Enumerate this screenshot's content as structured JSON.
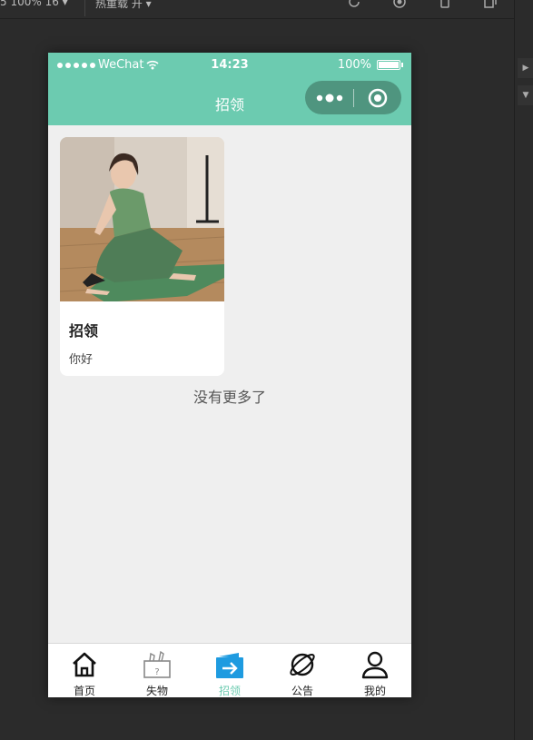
{
  "ide": {
    "zoom_label": "5 100% 16 ▾",
    "reload_label": "热重载 开 ▾"
  },
  "status_bar": {
    "carrier": "WeChat",
    "time": "14:23",
    "battery": "100%"
  },
  "navbar": {
    "title": "招领"
  },
  "card": {
    "title": "招领",
    "description": "你好"
  },
  "footer_text": "没有更多了",
  "tabs": [
    {
      "label": "首页",
      "icon": "home-icon"
    },
    {
      "label": "失物",
      "icon": "lost-box-icon"
    },
    {
      "label": "招领",
      "icon": "found-arrow-icon"
    },
    {
      "label": "公告",
      "icon": "planet-icon"
    },
    {
      "label": "我的",
      "icon": "user-icon"
    }
  ],
  "colors": {
    "accent": "#6ccbb0",
    "active_tab_icon": "#1e9be0",
    "page_bg": "#efefef"
  }
}
